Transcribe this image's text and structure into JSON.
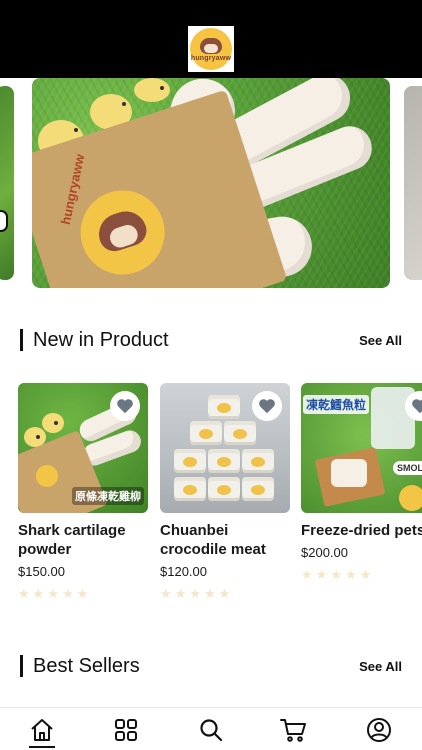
{
  "app": {
    "logo_text": "hungryaww"
  },
  "sections": {
    "new_in": {
      "title": "New in Product",
      "see_all": "See All"
    },
    "best_sellers": {
      "title": "Best Sellers",
      "see_all": "See All"
    }
  },
  "products": [
    {
      "name": "Shark cartilage powder",
      "price": "$150.00",
      "rating": 0,
      "image_text": "原條凍乾雞柳"
    },
    {
      "name": "Chuanbei crocodile meat",
      "price": "$120.00",
      "rating": 0
    },
    {
      "name": "Freeze-dried pets",
      "price": "$200.00",
      "rating": 0,
      "image_text": "凍乾鱈魚粒",
      "image_badge": "SMOLE"
    }
  ],
  "banner": {
    "bag_text": "hungryaww"
  },
  "nav": [
    "home-icon",
    "grid-icon",
    "search-icon",
    "cart-icon",
    "profile-icon"
  ],
  "colors": {
    "accent": "#111111",
    "star_empty": "#f3e6c9",
    "logo_bg": "#f6c342"
  }
}
